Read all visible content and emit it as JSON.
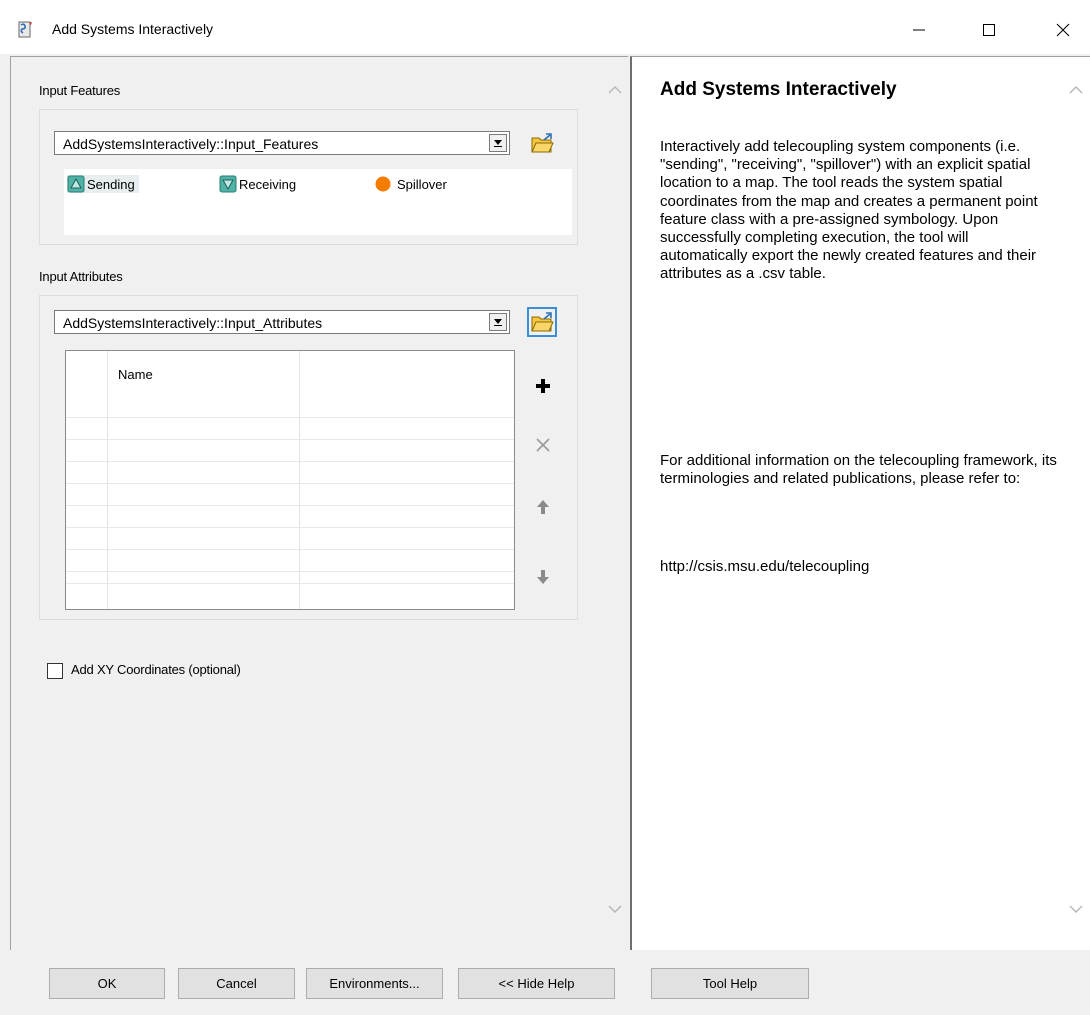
{
  "window": {
    "title": "Add Systems Interactively",
    "controls": {
      "minimize": "minimize",
      "maximize": "maximize",
      "close": "close"
    }
  },
  "input_features": {
    "label": "Input Features",
    "value": "AddSystemsInteractively::Input_Features",
    "symbology": [
      {
        "label": "Sending",
        "icon": "sending-triangle-icon",
        "color": "#4fb3a8"
      },
      {
        "label": "Receiving",
        "icon": "receiving-triangle-icon",
        "color": "#4fb3a8"
      },
      {
        "label": "Spillover",
        "icon": "spillover-circle-icon",
        "color": "#f57c00"
      }
    ]
  },
  "input_attributes": {
    "label": "Input Attributes",
    "value": "AddSystemsInteractively::Input_Attributes",
    "columns": [
      "Name"
    ],
    "rows": []
  },
  "optional": {
    "xy_label": "Add XY Coordinates (optional)",
    "xy_checked": false
  },
  "help": {
    "title": "Add Systems Interactively",
    "paragraph1": "Interactively add telecoupling system components (i.e. \"sending\", \"receiving\", \"spillover\") with an explicit spatial location to a map. The tool reads the system spatial coordinates from the map and creates a permanent point feature class with a pre-assigned symbology. Upon successfully completing execution, the tool will automatically export the newly created features and their attributes as a .csv table.",
    "paragraph2": "For additional information on the telecoupling framework, its terminologies and related publications, please refer to:",
    "url": "http://csis.msu.edu/telecoupling"
  },
  "buttons": {
    "ok": "OK",
    "cancel": "Cancel",
    "environments": "Environments...",
    "hide_help": "<< Hide Help",
    "tool_help": "Tool Help"
  },
  "colors": {
    "focus": "#3b8fd8",
    "symbol_teal": "#4fb3a8",
    "symbol_orange": "#f57c00",
    "folder": "#f5c542"
  }
}
